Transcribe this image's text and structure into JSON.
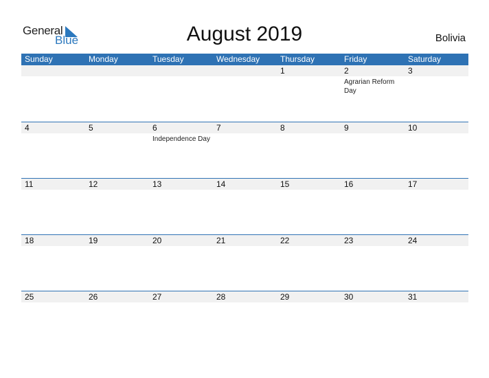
{
  "logo": {
    "word1": "General",
    "word2": "Blue"
  },
  "title": "August 2019",
  "country": "Bolivia",
  "colors": {
    "accent": "#2e72b4",
    "dayband": "#f1f1f1"
  },
  "weekdays": [
    "Sunday",
    "Monday",
    "Tuesday",
    "Wednesday",
    "Thursday",
    "Friday",
    "Saturday"
  ],
  "weeks": [
    [
      {
        "d": "",
        "e": ""
      },
      {
        "d": "",
        "e": ""
      },
      {
        "d": "",
        "e": ""
      },
      {
        "d": "",
        "e": ""
      },
      {
        "d": "1",
        "e": ""
      },
      {
        "d": "2",
        "e": "Agrarian Reform Day"
      },
      {
        "d": "3",
        "e": ""
      }
    ],
    [
      {
        "d": "4",
        "e": ""
      },
      {
        "d": "5",
        "e": ""
      },
      {
        "d": "6",
        "e": "Independence Day"
      },
      {
        "d": "7",
        "e": ""
      },
      {
        "d": "8",
        "e": ""
      },
      {
        "d": "9",
        "e": ""
      },
      {
        "d": "10",
        "e": ""
      }
    ],
    [
      {
        "d": "11",
        "e": ""
      },
      {
        "d": "12",
        "e": ""
      },
      {
        "d": "13",
        "e": ""
      },
      {
        "d": "14",
        "e": ""
      },
      {
        "d": "15",
        "e": ""
      },
      {
        "d": "16",
        "e": ""
      },
      {
        "d": "17",
        "e": ""
      }
    ],
    [
      {
        "d": "18",
        "e": ""
      },
      {
        "d": "19",
        "e": ""
      },
      {
        "d": "20",
        "e": ""
      },
      {
        "d": "21",
        "e": ""
      },
      {
        "d": "22",
        "e": ""
      },
      {
        "d": "23",
        "e": ""
      },
      {
        "d": "24",
        "e": ""
      }
    ],
    [
      {
        "d": "25",
        "e": ""
      },
      {
        "d": "26",
        "e": ""
      },
      {
        "d": "27",
        "e": ""
      },
      {
        "d": "28",
        "e": ""
      },
      {
        "d": "29",
        "e": ""
      },
      {
        "d": "30",
        "e": ""
      },
      {
        "d": "31",
        "e": ""
      }
    ]
  ]
}
